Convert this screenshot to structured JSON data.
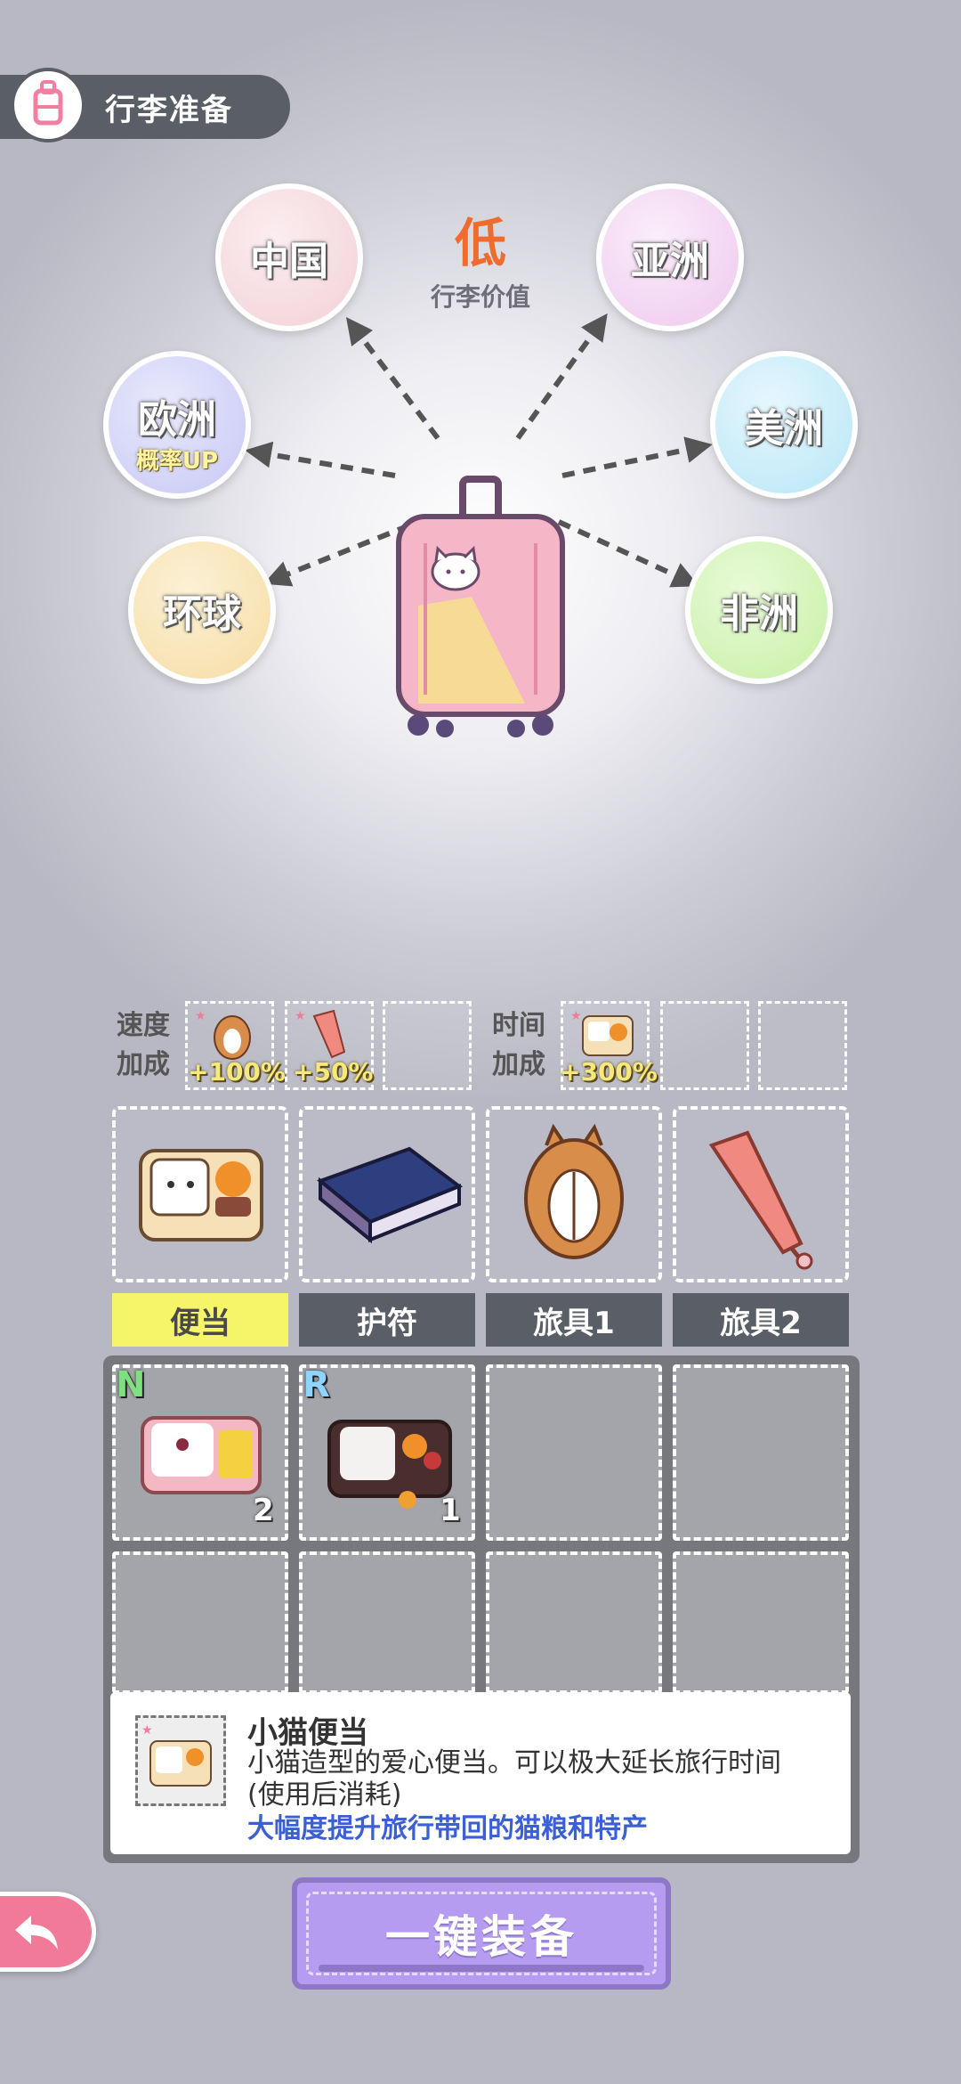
{
  "header": {
    "title": "行李准备",
    "icon": "suitcase-icon"
  },
  "luggage_value": {
    "level": "低",
    "label": "行李价值"
  },
  "regions": [
    {
      "id": "china",
      "name": "中国",
      "color": "#f3d0d6"
    },
    {
      "id": "asia",
      "name": "亚洲",
      "color": "#efc8ee"
    },
    {
      "id": "europe",
      "name": "欧洲",
      "badge": "概率UP",
      "color": "#c7c8f5",
      "crowned": true
    },
    {
      "id": "america",
      "name": "美洲",
      "color": "#b8e6f7"
    },
    {
      "id": "global",
      "name": "环球",
      "color": "#f6dca3"
    },
    {
      "id": "africa",
      "name": "非洲",
      "color": "#c6f0a4"
    }
  ],
  "bonus": {
    "speed": {
      "label_line1": "速度",
      "label_line2": "加成",
      "slots": [
        {
          "item": "cat-sleeping-bag",
          "value": "+100%"
        },
        {
          "item": "umbrella",
          "value": "+50%"
        },
        {
          "item": "",
          "value": ""
        }
      ]
    },
    "time": {
      "label_line1": "时间",
      "label_line2": "加成",
      "slots": [
        {
          "item": "cat-bento",
          "value": "+300%"
        },
        {
          "item": "",
          "value": ""
        },
        {
          "item": "",
          "value": ""
        }
      ]
    }
  },
  "equipped": [
    "cat-bento",
    "book",
    "cat-sleeping-bag",
    "umbrella"
  ],
  "tabs": [
    {
      "label": "便当",
      "active": true
    },
    {
      "label": "护符"
    },
    {
      "label": "旅具1"
    },
    {
      "label": "旅具2"
    }
  ],
  "inventory": [
    {
      "rarity": "N",
      "rarity_color": "#7ee07e",
      "count": "2",
      "item": "plain-bento"
    },
    {
      "rarity": "R",
      "rarity_color": "#8fd3ff",
      "count": "1",
      "item": "rice-bento"
    }
  ],
  "detail": {
    "title": "小猫便当",
    "description": "小猫造型的爱心便当。可以极大延长旅行时间(使用后消耗)",
    "highlight": "大幅度提升旅行带回的猫粮和特产"
  },
  "buttons": {
    "equip_all": "一键装备",
    "back_icon": "back-arrow-icon"
  }
}
